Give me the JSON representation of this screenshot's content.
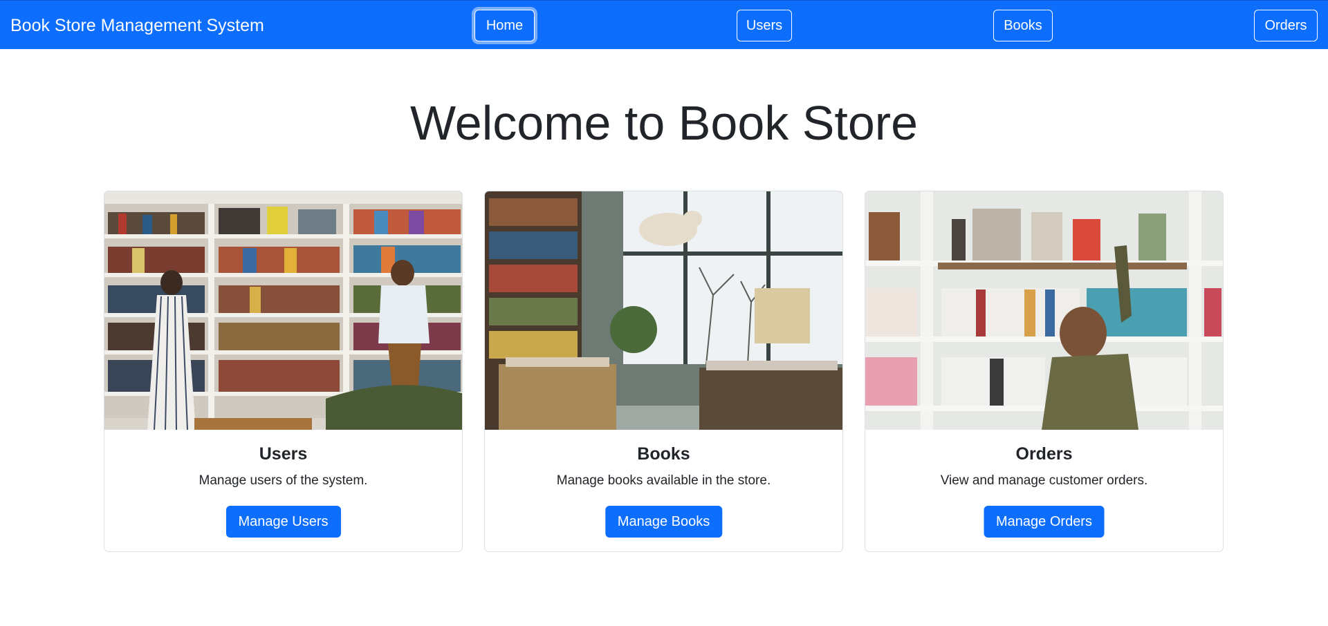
{
  "navbar": {
    "brand": "Book Store Management System",
    "links": [
      "Home",
      "Users",
      "Books",
      "Orders"
    ],
    "active": "Home",
    "color": "#0d6efd"
  },
  "main": {
    "heading": "Welcome to Book Store",
    "cards": [
      {
        "title": "Users",
        "text": "Manage users of the system.",
        "button": "Manage Users",
        "image": "bookshelf-people-photo"
      },
      {
        "title": "Books",
        "text": "Manage books available in the store.",
        "button": "Manage Books",
        "image": "bookstore-interior-photo"
      },
      {
        "title": "Orders",
        "text": "View and manage customer orders.",
        "button": "Manage Orders",
        "image": "woman-reaching-shelf-photo"
      }
    ],
    "button_color": "#0d6efd"
  }
}
